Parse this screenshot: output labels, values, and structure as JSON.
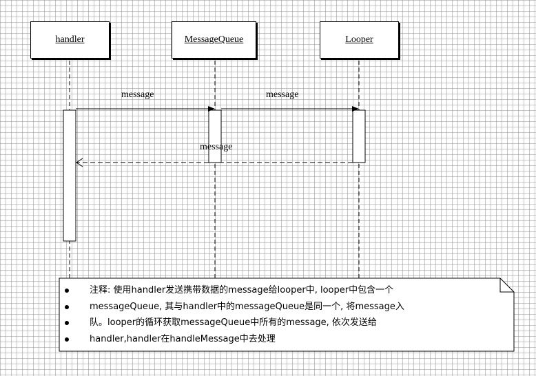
{
  "lifelines": [
    {
      "id": "handler",
      "label": "handler"
    },
    {
      "id": "queue",
      "label": "MessageQueue"
    },
    {
      "id": "looper",
      "label": "Looper"
    }
  ],
  "messages": [
    {
      "label": "message",
      "from": "handler",
      "to": "queue",
      "style": "solid"
    },
    {
      "label": "message",
      "from": "queue",
      "to": "looper",
      "style": "solid"
    },
    {
      "label": "message",
      "from": "looper",
      "to": "handler",
      "style": "dashed"
    }
  ],
  "note": {
    "lines": [
      "注释: 使用handler发送携带数据的message给looper中, looper中包含一个",
      "messageQueue, 其与handler中的messageQueue是同一个, 将message入",
      "队。looper的循环获取messageQueue中所有的message, 依次发送给",
      "handler,handler在handleMessage中去处理"
    ]
  }
}
